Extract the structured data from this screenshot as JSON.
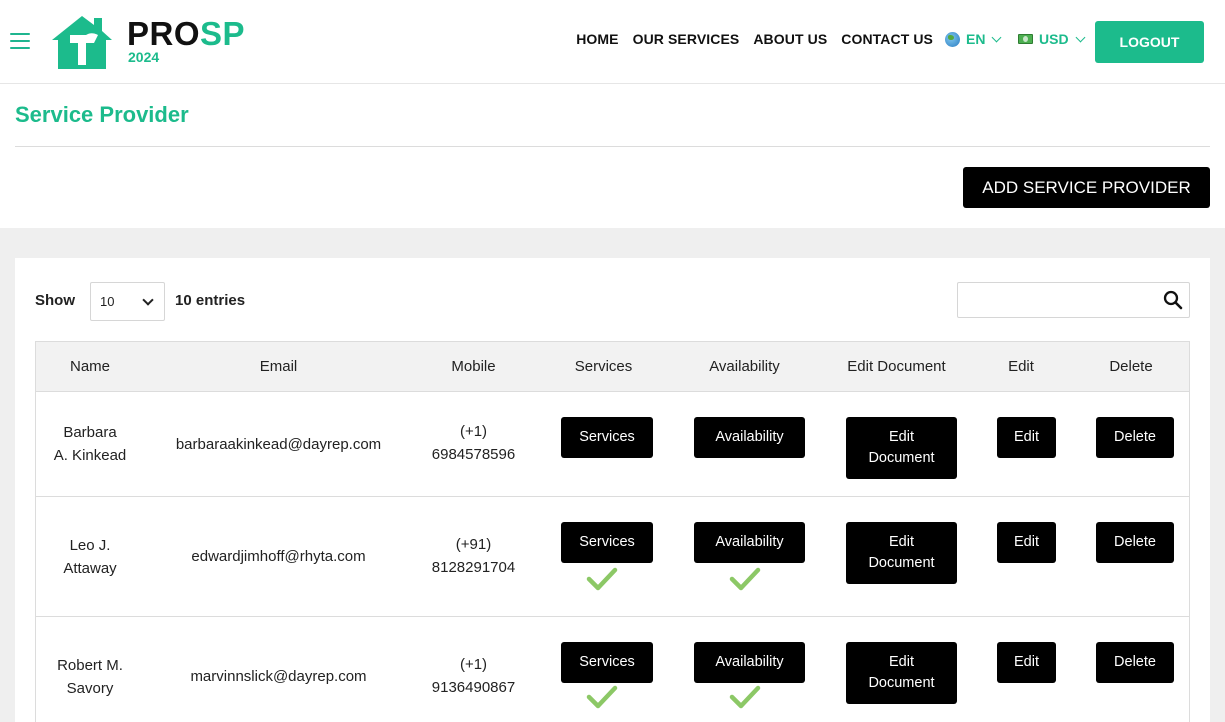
{
  "brand": {
    "name_a": "PRO",
    "name_b": "SP",
    "year": "2024"
  },
  "nav": [
    {
      "id": "home",
      "label": "HOME"
    },
    {
      "id": "services",
      "label": "OUR SERVICES"
    },
    {
      "id": "about",
      "label": "ABOUT US"
    },
    {
      "id": "contact",
      "label": "CONTACT US"
    }
  ],
  "language": {
    "label": "EN"
  },
  "currency": {
    "label": "USD"
  },
  "logout_label": "LOGOUT",
  "page": {
    "title": "Service Provider",
    "add_button": "ADD SERVICE PROVIDER"
  },
  "table_controls": {
    "show_label": "Show",
    "page_size": "10",
    "entries_label": "10 entries",
    "search_value": ""
  },
  "table": {
    "columns": [
      "Name",
      "Email",
      "Mobile",
      "Services",
      "Availability",
      "Edit Document",
      "Edit",
      "Delete"
    ],
    "buttons": {
      "services": "Services",
      "availability": "Availability",
      "edit_document_1": "Edit",
      "edit_document_2": "Document",
      "edit": "Edit",
      "delete": "Delete"
    },
    "rows": [
      {
        "name_1": "Barbara",
        "name_2": "A. Kinkead",
        "email": "barbaraakinkead@dayrep.com",
        "code": "(+1)",
        "phone": "6984578596",
        "services_done": false,
        "availability_done": false
      },
      {
        "name_1": "Leo J.",
        "name_2": "Attaway",
        "email": "edwardjimhoff@rhyta.com",
        "code": "(+91)",
        "phone": "8128291704",
        "services_done": true,
        "availability_done": true
      },
      {
        "name_1": "Robert M.",
        "name_2": "Savory",
        "email": "marvinnslick@dayrep.com",
        "code": "(+1)",
        "phone": "9136490867",
        "services_done": true,
        "availability_done": true
      }
    ]
  },
  "colors": {
    "accent": "#1cbb8c",
    "check": "#8cc866",
    "button": "#000000"
  }
}
